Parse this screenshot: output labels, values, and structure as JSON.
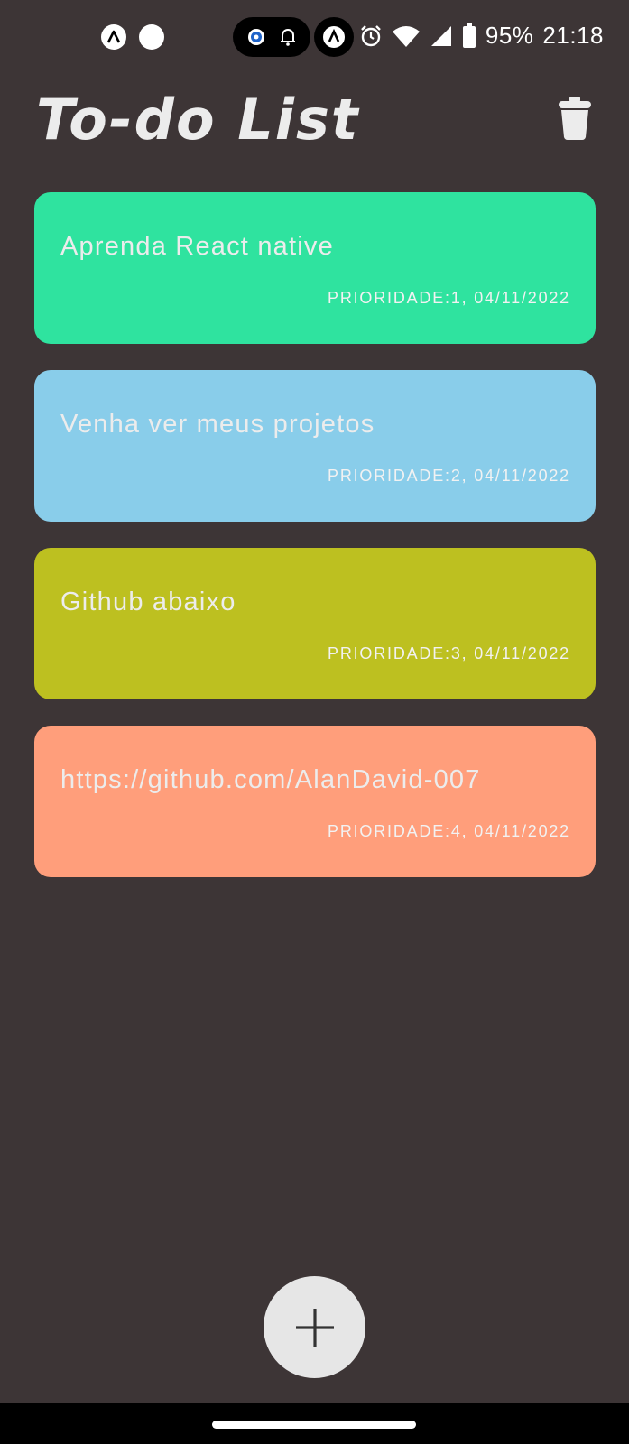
{
  "status_bar": {
    "battery": "95%",
    "time": "21:18",
    "icons": [
      "expo-icon",
      "circle-icon",
      "vpn-icon",
      "bell-icon",
      "download-icon",
      "alarm-icon",
      "wifi-icon",
      "signal-icon",
      "battery-icon"
    ]
  },
  "header": {
    "title": "To-do List",
    "trash_icon": "trash-icon"
  },
  "todos": [
    {
      "text": "Aprenda React native",
      "meta": "PRIORIDADE:1, 04/11/2022",
      "color": "#2fe39f"
    },
    {
      "text": "Venha ver meus projetos",
      "meta": "PRIORIDADE:2, 04/11/2022",
      "color": "#89cdea"
    },
    {
      "text": "Github abaixo",
      "meta": "PRIORIDADE:3, 04/11/2022",
      "color": "#bdc020"
    },
    {
      "text": "https://github.com/AlanDavid-007",
      "meta": "PRIORIDADE:4, 04/11/2022",
      "color": "#ff9e7b"
    }
  ],
  "fab": {
    "icon": "plus-icon"
  }
}
